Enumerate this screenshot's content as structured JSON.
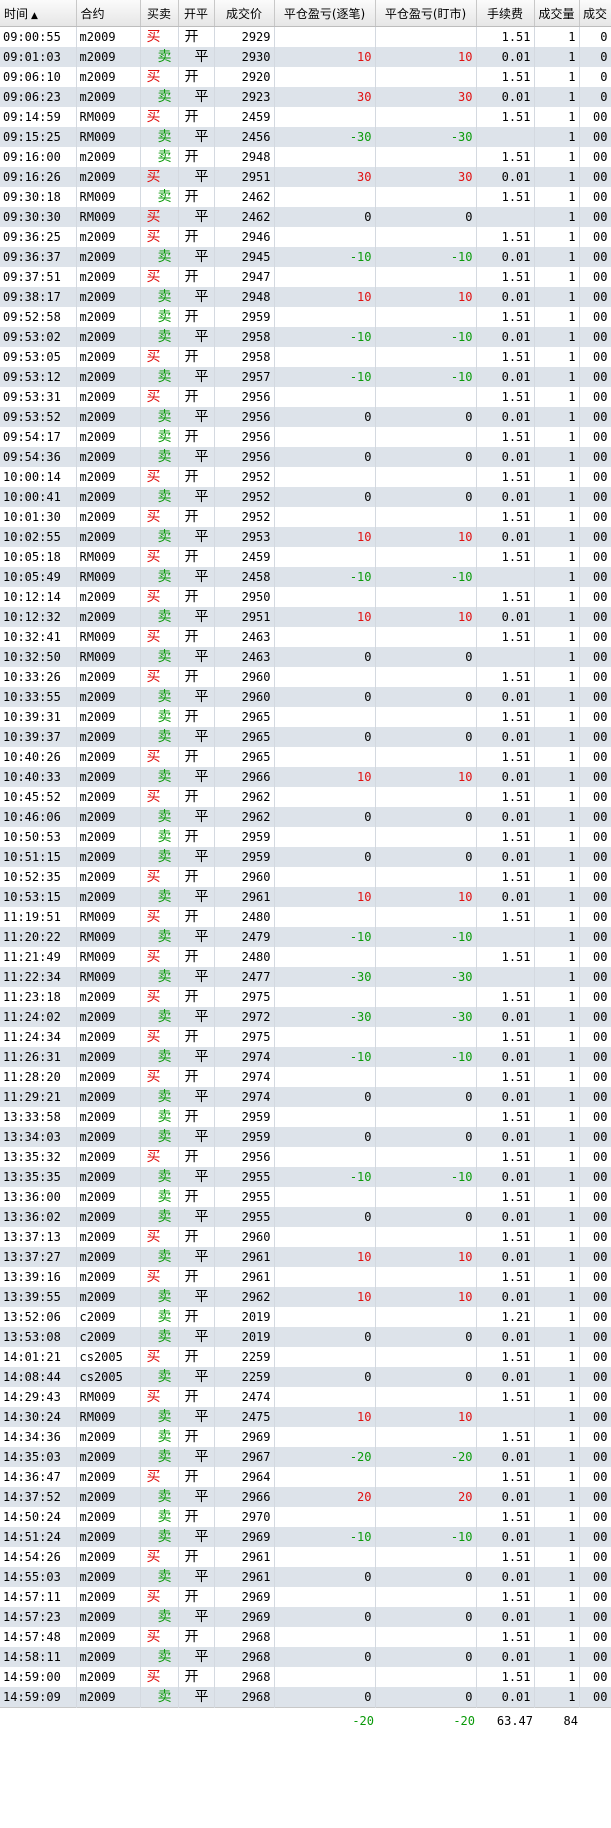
{
  "header": {
    "columns": [
      "时间",
      "合约",
      "买卖",
      "开平",
      "成交价",
      "平仓盈亏(逐笔)",
      "平仓盈亏(盯市)",
      "手续费",
      "成交量",
      "成交"
    ],
    "sort_indicator": "▲"
  },
  "rows": [
    [
      "09:00:55",
      "m2009",
      "买",
      "开",
      "2929",
      "",
      "",
      "1.51",
      "1",
      "0"
    ],
    [
      "09:01:03",
      "m2009",
      "卖",
      "平",
      "2930",
      "10",
      "10",
      "0.01",
      "1",
      "0"
    ],
    [
      "09:06:10",
      "m2009",
      "买",
      "开",
      "2920",
      "",
      "",
      "1.51",
      "1",
      "0"
    ],
    [
      "09:06:23",
      "m2009",
      "卖",
      "平",
      "2923",
      "30",
      "30",
      "0.01",
      "1",
      "0"
    ],
    [
      "09:14:59",
      "RM009",
      "买",
      "开",
      "2459",
      "",
      "",
      "1.51",
      "1",
      "00"
    ],
    [
      "09:15:25",
      "RM009",
      "卖",
      "平",
      "2456",
      "-30",
      "-30",
      "",
      "1",
      "00"
    ],
    [
      "09:16:00",
      "m2009",
      "卖",
      "开",
      "2948",
      "",
      "",
      "1.51",
      "1",
      "00"
    ],
    [
      "09:16:26",
      "m2009",
      "买",
      "平",
      "2951",
      "30",
      "30",
      "0.01",
      "1",
      "00"
    ],
    [
      "09:30:18",
      "RM009",
      "卖",
      "开",
      "2462",
      "",
      "",
      "1.51",
      "1",
      "00"
    ],
    [
      "09:30:30",
      "RM009",
      "买",
      "平",
      "2462",
      "0",
      "0",
      "",
      "1",
      "00"
    ],
    [
      "09:36:25",
      "m2009",
      "买",
      "开",
      "2946",
      "",
      "",
      "1.51",
      "1",
      "00"
    ],
    [
      "09:36:37",
      "m2009",
      "卖",
      "平",
      "2945",
      "-10",
      "-10",
      "0.01",
      "1",
      "00"
    ],
    [
      "09:37:51",
      "m2009",
      "买",
      "开",
      "2947",
      "",
      "",
      "1.51",
      "1",
      "00"
    ],
    [
      "09:38:17",
      "m2009",
      "卖",
      "平",
      "2948",
      "10",
      "10",
      "0.01",
      "1",
      "00"
    ],
    [
      "09:52:58",
      "m2009",
      "卖",
      "开",
      "2959",
      "",
      "",
      "1.51",
      "1",
      "00"
    ],
    [
      "09:53:02",
      "m2009",
      "卖",
      "平",
      "2958",
      "-10",
      "-10",
      "0.01",
      "1",
      "00"
    ],
    [
      "09:53:05",
      "m2009",
      "买",
      "开",
      "2958",
      "",
      "",
      "1.51",
      "1",
      "00"
    ],
    [
      "09:53:12",
      "m2009",
      "卖",
      "平",
      "2957",
      "-10",
      "-10",
      "0.01",
      "1",
      "00"
    ],
    [
      "09:53:31",
      "m2009",
      "买",
      "开",
      "2956",
      "",
      "",
      "1.51",
      "1",
      "00"
    ],
    [
      "09:53:52",
      "m2009",
      "卖",
      "平",
      "2956",
      "0",
      "0",
      "0.01",
      "1",
      "00"
    ],
    [
      "09:54:17",
      "m2009",
      "卖",
      "开",
      "2956",
      "",
      "",
      "1.51",
      "1",
      "00"
    ],
    [
      "09:54:36",
      "m2009",
      "卖",
      "平",
      "2956",
      "0",
      "0",
      "0.01",
      "1",
      "00"
    ],
    [
      "10:00:14",
      "m2009",
      "买",
      "开",
      "2952",
      "",
      "",
      "1.51",
      "1",
      "00"
    ],
    [
      "10:00:41",
      "m2009",
      "卖",
      "平",
      "2952",
      "0",
      "0",
      "0.01",
      "1",
      "00"
    ],
    [
      "10:01:30",
      "m2009",
      "买",
      "开",
      "2952",
      "",
      "",
      "1.51",
      "1",
      "00"
    ],
    [
      "10:02:55",
      "m2009",
      "卖",
      "平",
      "2953",
      "10",
      "10",
      "0.01",
      "1",
      "00"
    ],
    [
      "10:05:18",
      "RM009",
      "买",
      "开",
      "2459",
      "",
      "",
      "1.51",
      "1",
      "00"
    ],
    [
      "10:05:49",
      "RM009",
      "卖",
      "平",
      "2458",
      "-10",
      "-10",
      "",
      "1",
      "00"
    ],
    [
      "10:12:14",
      "m2009",
      "买",
      "开",
      "2950",
      "",
      "",
      "1.51",
      "1",
      "00"
    ],
    [
      "10:12:32",
      "m2009",
      "卖",
      "平",
      "2951",
      "10",
      "10",
      "0.01",
      "1",
      "00"
    ],
    [
      "10:32:41",
      "RM009",
      "买",
      "开",
      "2463",
      "",
      "",
      "1.51",
      "1",
      "00"
    ],
    [
      "10:32:50",
      "RM009",
      "卖",
      "平",
      "2463",
      "0",
      "0",
      "",
      "1",
      "00"
    ],
    [
      "10:33:26",
      "m2009",
      "买",
      "开",
      "2960",
      "",
      "",
      "1.51",
      "1",
      "00"
    ],
    [
      "10:33:55",
      "m2009",
      "卖",
      "平",
      "2960",
      "0",
      "0",
      "0.01",
      "1",
      "00"
    ],
    [
      "10:39:31",
      "m2009",
      "卖",
      "开",
      "2965",
      "",
      "",
      "1.51",
      "1",
      "00"
    ],
    [
      "10:39:37",
      "m2009",
      "卖",
      "平",
      "2965",
      "0",
      "0",
      "0.01",
      "1",
      "00"
    ],
    [
      "10:40:26",
      "m2009",
      "买",
      "开",
      "2965",
      "",
      "",
      "1.51",
      "1",
      "00"
    ],
    [
      "10:40:33",
      "m2009",
      "卖",
      "平",
      "2966",
      "10",
      "10",
      "0.01",
      "1",
      "00"
    ],
    [
      "10:45:52",
      "m2009",
      "买",
      "开",
      "2962",
      "",
      "",
      "1.51",
      "1",
      "00"
    ],
    [
      "10:46:06",
      "m2009",
      "卖",
      "平",
      "2962",
      "0",
      "0",
      "0.01",
      "1",
      "00"
    ],
    [
      "10:50:53",
      "m2009",
      "卖",
      "开",
      "2959",
      "",
      "",
      "1.51",
      "1",
      "00"
    ],
    [
      "10:51:15",
      "m2009",
      "卖",
      "平",
      "2959",
      "0",
      "0",
      "0.01",
      "1",
      "00"
    ],
    [
      "10:52:35",
      "m2009",
      "买",
      "开",
      "2960",
      "",
      "",
      "1.51",
      "1",
      "00"
    ],
    [
      "10:53:15",
      "m2009",
      "卖",
      "平",
      "2961",
      "10",
      "10",
      "0.01",
      "1",
      "00"
    ],
    [
      "11:19:51",
      "RM009",
      "买",
      "开",
      "2480",
      "",
      "",
      "1.51",
      "1",
      "00"
    ],
    [
      "11:20:22",
      "RM009",
      "卖",
      "平",
      "2479",
      "-10",
      "-10",
      "",
      "1",
      "00"
    ],
    [
      "11:21:49",
      "RM009",
      "买",
      "开",
      "2480",
      "",
      "",
      "1.51",
      "1",
      "00"
    ],
    [
      "11:22:34",
      "RM009",
      "卖",
      "平",
      "2477",
      "-30",
      "-30",
      "",
      "1",
      "00"
    ],
    [
      "11:23:18",
      "m2009",
      "买",
      "开",
      "2975",
      "",
      "",
      "1.51",
      "1",
      "00"
    ],
    [
      "11:24:02",
      "m2009",
      "卖",
      "平",
      "2972",
      "-30",
      "-30",
      "0.01",
      "1",
      "00"
    ],
    [
      "11:24:34",
      "m2009",
      "买",
      "开",
      "2975",
      "",
      "",
      "1.51",
      "1",
      "00"
    ],
    [
      "11:26:31",
      "m2009",
      "卖",
      "平",
      "2974",
      "-10",
      "-10",
      "0.01",
      "1",
      "00"
    ],
    [
      "11:28:20",
      "m2009",
      "买",
      "开",
      "2974",
      "",
      "",
      "1.51",
      "1",
      "00"
    ],
    [
      "11:29:21",
      "m2009",
      "卖",
      "平",
      "2974",
      "0",
      "0",
      "0.01",
      "1",
      "00"
    ],
    [
      "13:33:58",
      "m2009",
      "卖",
      "开",
      "2959",
      "",
      "",
      "1.51",
      "1",
      "00"
    ],
    [
      "13:34:03",
      "m2009",
      "卖",
      "平",
      "2959",
      "0",
      "0",
      "0.01",
      "1",
      "00"
    ],
    [
      "13:35:32",
      "m2009",
      "买",
      "开",
      "2956",
      "",
      "",
      "1.51",
      "1",
      "00"
    ],
    [
      "13:35:35",
      "m2009",
      "卖",
      "平",
      "2955",
      "-10",
      "-10",
      "0.01",
      "1",
      "00"
    ],
    [
      "13:36:00",
      "m2009",
      "卖",
      "开",
      "2955",
      "",
      "",
      "1.51",
      "1",
      "00"
    ],
    [
      "13:36:02",
      "m2009",
      "卖",
      "平",
      "2955",
      "0",
      "0",
      "0.01",
      "1",
      "00"
    ],
    [
      "13:37:13",
      "m2009",
      "买",
      "开",
      "2960",
      "",
      "",
      "1.51",
      "1",
      "00"
    ],
    [
      "13:37:27",
      "m2009",
      "卖",
      "平",
      "2961",
      "10",
      "10",
      "0.01",
      "1",
      "00"
    ],
    [
      "13:39:16",
      "m2009",
      "买",
      "开",
      "2961",
      "",
      "",
      "1.51",
      "1",
      "00"
    ],
    [
      "13:39:55",
      "m2009",
      "卖",
      "平",
      "2962",
      "10",
      "10",
      "0.01",
      "1",
      "00"
    ],
    [
      "13:52:06",
      "c2009",
      "卖",
      "开",
      "2019",
      "",
      "",
      "1.21",
      "1",
      "00"
    ],
    [
      "13:53:08",
      "c2009",
      "卖",
      "平",
      "2019",
      "0",
      "0",
      "0.01",
      "1",
      "00"
    ],
    [
      "14:01:21",
      "cs2005",
      "买",
      "开",
      "2259",
      "",
      "",
      "1.51",
      "1",
      "00"
    ],
    [
      "14:08:44",
      "cs2005",
      "卖",
      "平",
      "2259",
      "0",
      "0",
      "0.01",
      "1",
      "00"
    ],
    [
      "14:29:43",
      "RM009",
      "买",
      "开",
      "2474",
      "",
      "",
      "1.51",
      "1",
      "00"
    ],
    [
      "14:30:24",
      "RM009",
      "卖",
      "平",
      "2475",
      "10",
      "10",
      "",
      "1",
      "00"
    ],
    [
      "14:34:36",
      "m2009",
      "卖",
      "开",
      "2969",
      "",
      "",
      "1.51",
      "1",
      "00"
    ],
    [
      "14:35:03",
      "m2009",
      "卖",
      "平",
      "2967",
      "-20",
      "-20",
      "0.01",
      "1",
      "00"
    ],
    [
      "14:36:47",
      "m2009",
      "买",
      "开",
      "2964",
      "",
      "",
      "1.51",
      "1",
      "00"
    ],
    [
      "14:37:52",
      "m2009",
      "卖",
      "平",
      "2966",
      "20",
      "20",
      "0.01",
      "1",
      "00"
    ],
    [
      "14:50:24",
      "m2009",
      "卖",
      "开",
      "2970",
      "",
      "",
      "1.51",
      "1",
      "00"
    ],
    [
      "14:51:24",
      "m2009",
      "卖",
      "平",
      "2969",
      "-10",
      "-10",
      "0.01",
      "1",
      "00"
    ],
    [
      "14:54:26",
      "m2009",
      "买",
      "开",
      "2961",
      "",
      "",
      "1.51",
      "1",
      "00"
    ],
    [
      "14:55:03",
      "m2009",
      "卖",
      "平",
      "2961",
      "0",
      "0",
      "0.01",
      "1",
      "00"
    ],
    [
      "14:57:11",
      "m2009",
      "买",
      "开",
      "2969",
      "",
      "",
      "1.51",
      "1",
      "00"
    ],
    [
      "14:57:23",
      "m2009",
      "卖",
      "平",
      "2969",
      "0",
      "0",
      "0.01",
      "1",
      "00"
    ],
    [
      "14:57:48",
      "m2009",
      "买",
      "开",
      "2968",
      "",
      "",
      "1.51",
      "1",
      "00"
    ],
    [
      "14:58:11",
      "m2009",
      "卖",
      "平",
      "2968",
      "0",
      "0",
      "0.01",
      "1",
      "00"
    ],
    [
      "14:59:00",
      "m2009",
      "买",
      "开",
      "2968",
      "",
      "",
      "1.51",
      "1",
      "00"
    ],
    [
      "14:59:09",
      "m2009",
      "卖",
      "平",
      "2968",
      "0",
      "0",
      "0.01",
      "1",
      "00"
    ]
  ],
  "totals": [
    "",
    "",
    "",
    "",
    "",
    "-20",
    "-20",
    "63.47",
    "84",
    ""
  ],
  "colors": {
    "buy": "#e01010",
    "sell": "#0a9a0a",
    "row_alt": "#dde3ea"
  }
}
